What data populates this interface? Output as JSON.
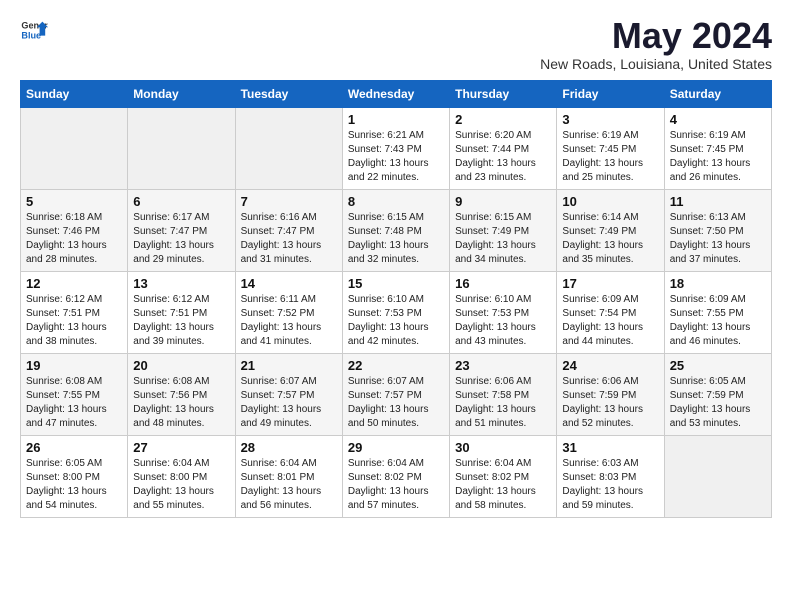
{
  "header": {
    "logo_general": "General",
    "logo_blue": "Blue",
    "month_title": "May 2024",
    "subtitle": "New Roads, Louisiana, United States"
  },
  "calendar": {
    "days_of_week": [
      "Sunday",
      "Monday",
      "Tuesday",
      "Wednesday",
      "Thursday",
      "Friday",
      "Saturday"
    ],
    "weeks": [
      [
        {
          "day": "",
          "empty": true
        },
        {
          "day": "",
          "empty": true
        },
        {
          "day": "",
          "empty": true
        },
        {
          "day": "1",
          "sunrise": "Sunrise: 6:21 AM",
          "sunset": "Sunset: 7:43 PM",
          "daylight": "Daylight: 13 hours and 22 minutes."
        },
        {
          "day": "2",
          "sunrise": "Sunrise: 6:20 AM",
          "sunset": "Sunset: 7:44 PM",
          "daylight": "Daylight: 13 hours and 23 minutes."
        },
        {
          "day": "3",
          "sunrise": "Sunrise: 6:19 AM",
          "sunset": "Sunset: 7:45 PM",
          "daylight": "Daylight: 13 hours and 25 minutes."
        },
        {
          "day": "4",
          "sunrise": "Sunrise: 6:19 AM",
          "sunset": "Sunset: 7:45 PM",
          "daylight": "Daylight: 13 hours and 26 minutes."
        }
      ],
      [
        {
          "day": "5",
          "sunrise": "Sunrise: 6:18 AM",
          "sunset": "Sunset: 7:46 PM",
          "daylight": "Daylight: 13 hours and 28 minutes."
        },
        {
          "day": "6",
          "sunrise": "Sunrise: 6:17 AM",
          "sunset": "Sunset: 7:47 PM",
          "daylight": "Daylight: 13 hours and 29 minutes."
        },
        {
          "day": "7",
          "sunrise": "Sunrise: 6:16 AM",
          "sunset": "Sunset: 7:47 PM",
          "daylight": "Daylight: 13 hours and 31 minutes."
        },
        {
          "day": "8",
          "sunrise": "Sunrise: 6:15 AM",
          "sunset": "Sunset: 7:48 PM",
          "daylight": "Daylight: 13 hours and 32 minutes."
        },
        {
          "day": "9",
          "sunrise": "Sunrise: 6:15 AM",
          "sunset": "Sunset: 7:49 PM",
          "daylight": "Daylight: 13 hours and 34 minutes."
        },
        {
          "day": "10",
          "sunrise": "Sunrise: 6:14 AM",
          "sunset": "Sunset: 7:49 PM",
          "daylight": "Daylight: 13 hours and 35 minutes."
        },
        {
          "day": "11",
          "sunrise": "Sunrise: 6:13 AM",
          "sunset": "Sunset: 7:50 PM",
          "daylight": "Daylight: 13 hours and 37 minutes."
        }
      ],
      [
        {
          "day": "12",
          "sunrise": "Sunrise: 6:12 AM",
          "sunset": "Sunset: 7:51 PM",
          "daylight": "Daylight: 13 hours and 38 minutes."
        },
        {
          "day": "13",
          "sunrise": "Sunrise: 6:12 AM",
          "sunset": "Sunset: 7:51 PM",
          "daylight": "Daylight: 13 hours and 39 minutes."
        },
        {
          "day": "14",
          "sunrise": "Sunrise: 6:11 AM",
          "sunset": "Sunset: 7:52 PM",
          "daylight": "Daylight: 13 hours and 41 minutes."
        },
        {
          "day": "15",
          "sunrise": "Sunrise: 6:10 AM",
          "sunset": "Sunset: 7:53 PM",
          "daylight": "Daylight: 13 hours and 42 minutes."
        },
        {
          "day": "16",
          "sunrise": "Sunrise: 6:10 AM",
          "sunset": "Sunset: 7:53 PM",
          "daylight": "Daylight: 13 hours and 43 minutes."
        },
        {
          "day": "17",
          "sunrise": "Sunrise: 6:09 AM",
          "sunset": "Sunset: 7:54 PM",
          "daylight": "Daylight: 13 hours and 44 minutes."
        },
        {
          "day": "18",
          "sunrise": "Sunrise: 6:09 AM",
          "sunset": "Sunset: 7:55 PM",
          "daylight": "Daylight: 13 hours and 46 minutes."
        }
      ],
      [
        {
          "day": "19",
          "sunrise": "Sunrise: 6:08 AM",
          "sunset": "Sunset: 7:55 PM",
          "daylight": "Daylight: 13 hours and 47 minutes."
        },
        {
          "day": "20",
          "sunrise": "Sunrise: 6:08 AM",
          "sunset": "Sunset: 7:56 PM",
          "daylight": "Daylight: 13 hours and 48 minutes."
        },
        {
          "day": "21",
          "sunrise": "Sunrise: 6:07 AM",
          "sunset": "Sunset: 7:57 PM",
          "daylight": "Daylight: 13 hours and 49 minutes."
        },
        {
          "day": "22",
          "sunrise": "Sunrise: 6:07 AM",
          "sunset": "Sunset: 7:57 PM",
          "daylight": "Daylight: 13 hours and 50 minutes."
        },
        {
          "day": "23",
          "sunrise": "Sunrise: 6:06 AM",
          "sunset": "Sunset: 7:58 PM",
          "daylight": "Daylight: 13 hours and 51 minutes."
        },
        {
          "day": "24",
          "sunrise": "Sunrise: 6:06 AM",
          "sunset": "Sunset: 7:59 PM",
          "daylight": "Daylight: 13 hours and 52 minutes."
        },
        {
          "day": "25",
          "sunrise": "Sunrise: 6:05 AM",
          "sunset": "Sunset: 7:59 PM",
          "daylight": "Daylight: 13 hours and 53 minutes."
        }
      ],
      [
        {
          "day": "26",
          "sunrise": "Sunrise: 6:05 AM",
          "sunset": "Sunset: 8:00 PM",
          "daylight": "Daylight: 13 hours and 54 minutes."
        },
        {
          "day": "27",
          "sunrise": "Sunrise: 6:04 AM",
          "sunset": "Sunset: 8:00 PM",
          "daylight": "Daylight: 13 hours and 55 minutes."
        },
        {
          "day": "28",
          "sunrise": "Sunrise: 6:04 AM",
          "sunset": "Sunset: 8:01 PM",
          "daylight": "Daylight: 13 hours and 56 minutes."
        },
        {
          "day": "29",
          "sunrise": "Sunrise: 6:04 AM",
          "sunset": "Sunset: 8:02 PM",
          "daylight": "Daylight: 13 hours and 57 minutes."
        },
        {
          "day": "30",
          "sunrise": "Sunrise: 6:04 AM",
          "sunset": "Sunset: 8:02 PM",
          "daylight": "Daylight: 13 hours and 58 minutes."
        },
        {
          "day": "31",
          "sunrise": "Sunrise: 6:03 AM",
          "sunset": "Sunset: 8:03 PM",
          "daylight": "Daylight: 13 hours and 59 minutes."
        },
        {
          "day": "",
          "empty": true
        }
      ]
    ]
  }
}
